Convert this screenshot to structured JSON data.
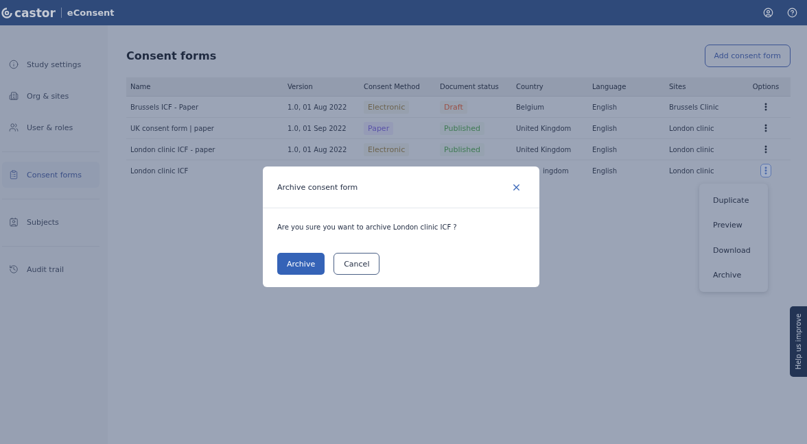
{
  "header": {
    "logo": "castor",
    "product": "eConsent"
  },
  "sidebar": {
    "items": [
      {
        "label": "Study settings",
        "selected": false
      },
      {
        "label": "Org & sites",
        "selected": false
      },
      {
        "label": "User & roles",
        "selected": false
      },
      {
        "label": "Consent forms",
        "selected": true
      },
      {
        "label": "Subjects",
        "selected": false
      },
      {
        "label": "Audit trail",
        "selected": false
      }
    ]
  },
  "page": {
    "title": "Consent forms",
    "add_button": "Add consent form"
  },
  "table": {
    "columns": [
      "Name",
      "Version",
      "Consent Method",
      "Document status",
      "Country",
      "Language",
      "Sites",
      "Options"
    ],
    "rows": [
      {
        "name": "Brussels ICF - Paper",
        "version": "1.0, 01 Aug 2022",
        "method": {
          "text": "Electronic",
          "kind": "electronic"
        },
        "status": {
          "text": "Draft",
          "kind": "draft"
        },
        "country": "Belgium",
        "language": "English",
        "sites": "Brussels Clinic",
        "menu_open": false
      },
      {
        "name": "UK consent form | paper",
        "version": "1.0, 01 Sep 2022",
        "method": {
          "text": "Paper",
          "kind": "paper"
        },
        "status": {
          "text": "Published",
          "kind": "published"
        },
        "country": "United Kingdom",
        "language": "English",
        "sites": "London clinic",
        "menu_open": false
      },
      {
        "name": "London clinic ICF - paper",
        "version": "1.0, 01 Aug 2022",
        "method": {
          "text": "Electronic",
          "kind": "electronic"
        },
        "status": {
          "text": "Published",
          "kind": "published"
        },
        "country": "United Kingdom",
        "language": "English",
        "sites": "London clinic",
        "menu_open": false
      },
      {
        "name": "London clinic ICF",
        "country": "ingdom",
        "country_partial": true,
        "language": "English",
        "sites": "London clinic",
        "menu_open": true
      }
    ]
  },
  "options_menu": [
    "Duplicate",
    "Preview",
    "Download",
    "Archive"
  ],
  "dialog": {
    "title": "Archive consent form",
    "message": "Are you sure you want to archive London clinic ICF ?",
    "confirm": "Archive",
    "cancel": "Cancel"
  },
  "feedback_tab": "Help us improve"
}
